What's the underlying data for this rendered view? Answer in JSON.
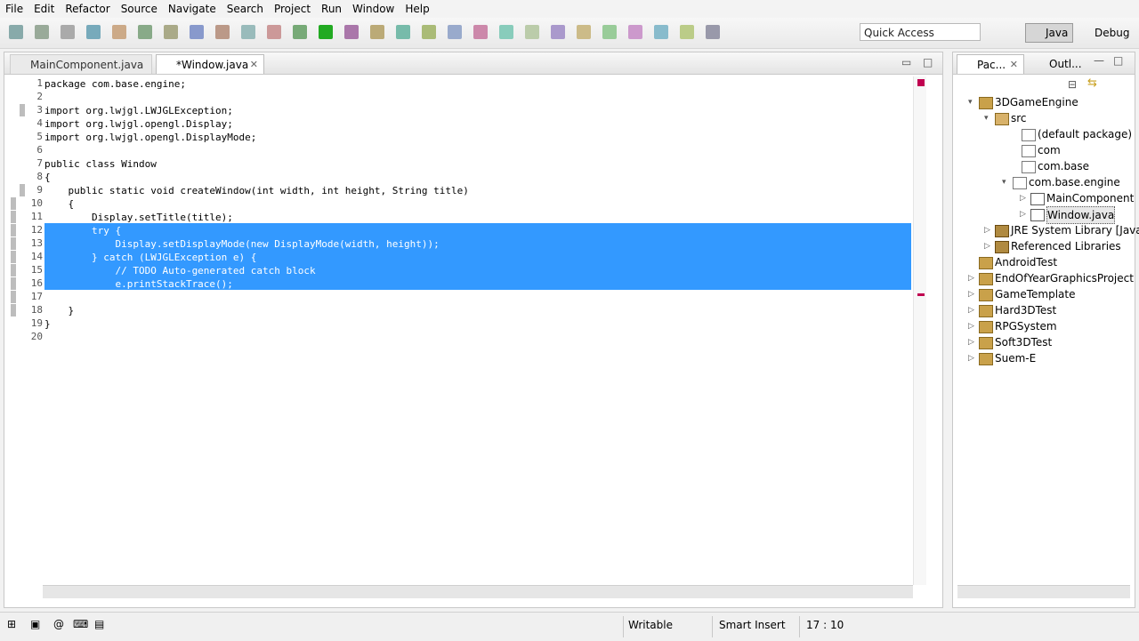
{
  "menu": [
    "File",
    "Edit",
    "Refactor",
    "Source",
    "Navigate",
    "Search",
    "Project",
    "Run",
    "Window",
    "Help"
  ],
  "quick_access": "Quick Access",
  "perspectives": {
    "java": "Java",
    "debug": "Debug"
  },
  "editor": {
    "tabs": [
      {
        "label": "MainComponent.java",
        "active": false
      },
      {
        "label": "*Window.java",
        "active": true
      }
    ],
    "lines": [
      {
        "n": "1",
        "text": "package com.base.engine;"
      },
      {
        "n": "2",
        "text": ""
      },
      {
        "n": "3",
        "text": "import org.lwjgl.LWJGLException;"
      },
      {
        "n": "4",
        "text": "import org.lwjgl.opengl.Display;"
      },
      {
        "n": "5",
        "text": "import org.lwjgl.opengl.DisplayMode;"
      },
      {
        "n": "6",
        "text": ""
      },
      {
        "n": "7",
        "text": "public class Window"
      },
      {
        "n": "8",
        "text": "{"
      },
      {
        "n": "9",
        "text": "    public static void createWindow(int width, int height, String title)"
      },
      {
        "n": "10",
        "text": "    {"
      },
      {
        "n": "11",
        "text": "        Display.setTitle(title);"
      },
      {
        "n": "12",
        "text": "        try {"
      },
      {
        "n": "13",
        "text": "            Display.setDisplayMode(new DisplayMode(width, height));"
      },
      {
        "n": "14",
        "text": "        } catch (LWJGLException e) {"
      },
      {
        "n": "15",
        "text": "            // TODO Auto-generated catch block"
      },
      {
        "n": "16",
        "text": "            e.printStackTrace();"
      },
      {
        "n": "17",
        "text": "        }"
      },
      {
        "n": "18",
        "text": "    }"
      },
      {
        "n": "19",
        "text": "}"
      },
      {
        "n": "20",
        "text": ""
      }
    ]
  },
  "package_explorer": {
    "tab_label": "Pac...",
    "outline_label": "Outl...",
    "items": [
      {
        "label": "3DGameEngine",
        "icon": "project-icon",
        "twisty": "▾"
      },
      {
        "label": "src",
        "icon": "source-folder-icon",
        "twisty": "▾"
      },
      {
        "label": "(default package)",
        "icon": "package-icon",
        "twisty": ""
      },
      {
        "label": "com",
        "icon": "package-icon",
        "twisty": ""
      },
      {
        "label": "com.base",
        "icon": "package-icon",
        "twisty": ""
      },
      {
        "label": "com.base.engine",
        "icon": "package-icon",
        "twisty": "▾"
      },
      {
        "label": "MainComponent",
        "icon": "java-file-icon",
        "twisty": "▷"
      },
      {
        "label": "Window.java",
        "icon": "java-file-icon",
        "twisty": "▷"
      },
      {
        "label": "JRE System Library [JavaS",
        "icon": "library-icon",
        "twisty": "▷"
      },
      {
        "label": "Referenced Libraries",
        "icon": "library-icon",
        "twisty": "▷"
      },
      {
        "label": "AndroidTest",
        "icon": "project-icon",
        "twisty": ""
      },
      {
        "label": "EndOfYearGraphicsProject",
        "icon": "project-icon",
        "twisty": "▷"
      },
      {
        "label": "GameTemplate",
        "icon": "project-icon",
        "twisty": "▷"
      },
      {
        "label": "Hard3DTest",
        "icon": "project-icon",
        "twisty": "▷"
      },
      {
        "label": "RPGSystem",
        "icon": "project-icon",
        "twisty": "▷"
      },
      {
        "label": "Soft3DTest",
        "icon": "project-icon",
        "twisty": "▷"
      },
      {
        "label": "Suem-E",
        "icon": "project-icon",
        "twisty": "▷"
      }
    ]
  },
  "status": {
    "writable": "Writable",
    "insert_mode": "Smart Insert",
    "position": "17 : 10"
  }
}
